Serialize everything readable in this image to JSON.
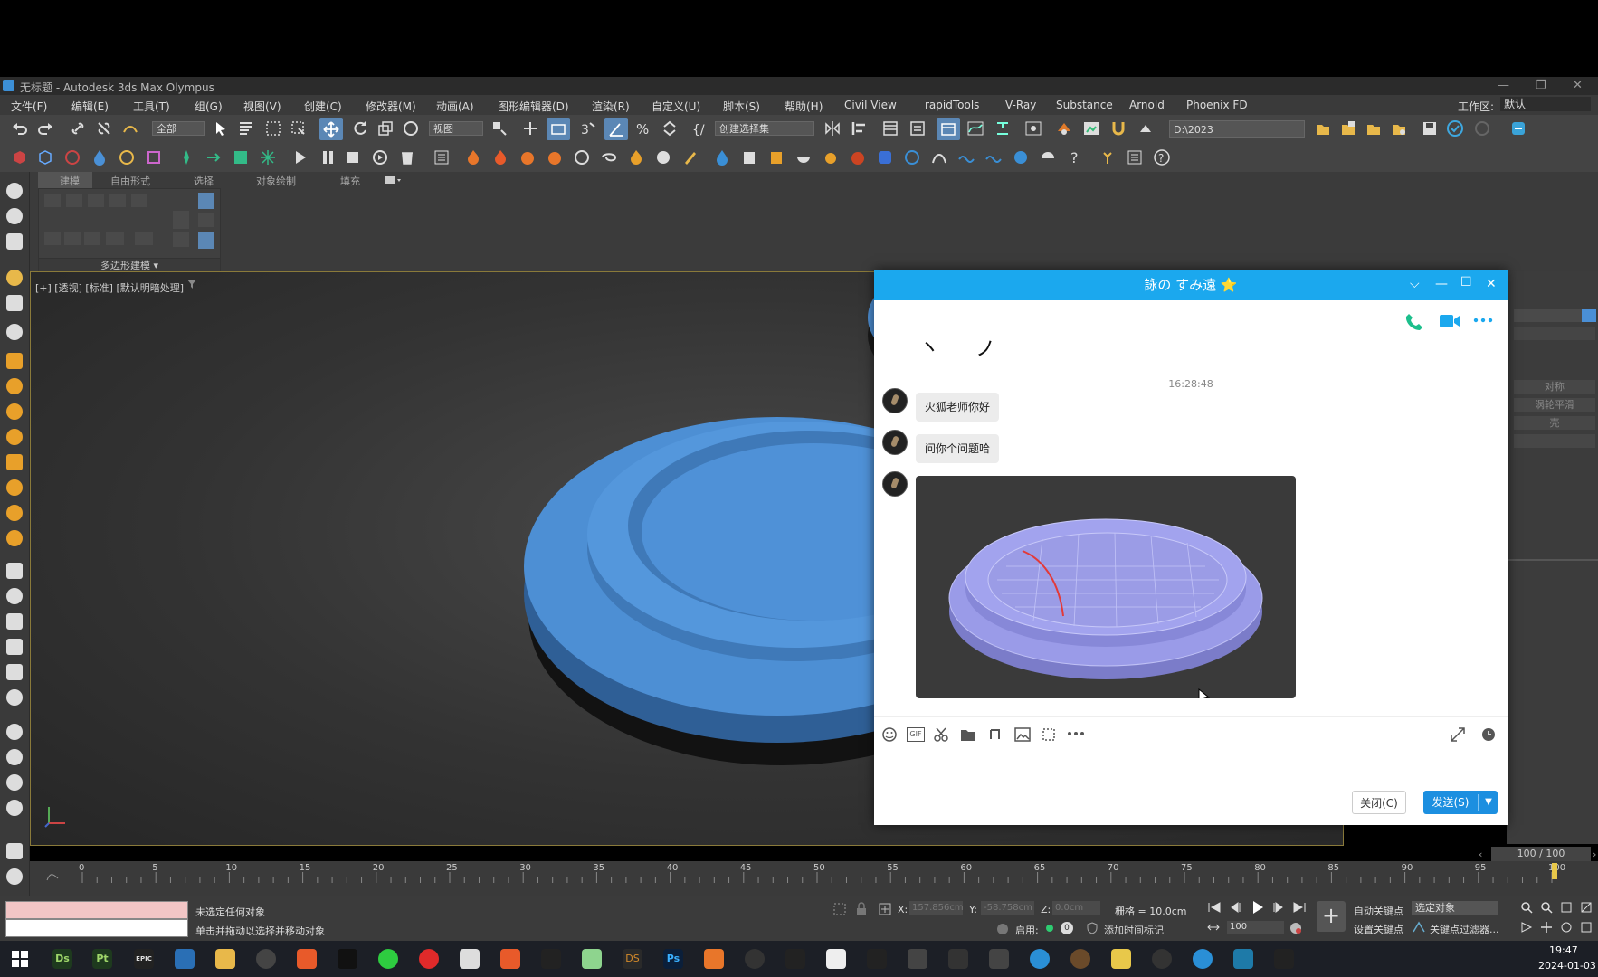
{
  "window": {
    "title": "无标题 - Autodesk 3ds Max Olympus",
    "controls": [
      "—",
      "❐",
      "✕"
    ]
  },
  "menu": {
    "items": [
      "文件(F)",
      "编辑(E)",
      "工具(T)",
      "组(G)",
      "视图(V)",
      "创建(C)",
      "修改器(M)",
      "动画(A)",
      "图形编辑器(D)",
      "渲染(R)",
      "自定义(U)",
      "脚本(S)",
      "帮助(H)",
      "Civil View",
      "rapidTools",
      "V-Ray",
      "Substance",
      "Arnold",
      "Phoenix FD"
    ],
    "workspace_label": "工作区:",
    "workspace_value": "默认"
  },
  "toolbar": {
    "selection_filter": "全部",
    "ref_coord": "视图",
    "named_selection": "创建选择集",
    "project_path": "D:\\2023"
  },
  "ribbon": {
    "tabs": [
      "建模",
      "自由形式",
      "选择",
      "对象绘制",
      "填充"
    ],
    "panel_label": "多边形建模"
  },
  "viewport": {
    "label": "[+] [透视] [标准] [默认明暗处理]",
    "model_color": "#4d8fd4"
  },
  "right_panel": {
    "items": [
      "对称",
      "涡轮平滑",
      "壳"
    ]
  },
  "timeline": {
    "frame_display": "100 / 100",
    "ticks": [
      "0",
      "5",
      "10",
      "15",
      "20",
      "25",
      "30",
      "35",
      "40",
      "45",
      "50",
      "55",
      "60",
      "65",
      "70",
      "75",
      "80",
      "85",
      "90",
      "95",
      "100"
    ]
  },
  "status": {
    "line1": "未选定任何对象",
    "line2": "单击并拖动以选择并移动对象",
    "x_label": "X:",
    "x_value": "157.856cm",
    "y_label": "Y:",
    "y_value": "-58.758cm",
    "z_label": "Z:",
    "z_value": "0.0cm",
    "grid": "栅格 = 10.0cm",
    "enable": "启用:",
    "add_time_tag": "添加时间标记",
    "auto_key": "自动关键点",
    "set_key": "设置关键点",
    "selected_objects": "选定对象",
    "key_filters": "关键点过滤器...",
    "frame_field": "100"
  },
  "chat": {
    "title": "詠の すみ遠 ⭐",
    "header_marks": [
      "ヽ",
      "ノ"
    ],
    "timestamp": "16:28:48",
    "messages": [
      "火狐老师你好",
      "问你个问题哈"
    ],
    "close_button": "关闭(C)",
    "send_button": "发送(S)",
    "gif_label": "GIF"
  },
  "taskbar": {
    "time": "19:47",
    "date": "2024-01-03",
    "apps": [
      "Ds",
      "Pt",
      "EPIC",
      "DS",
      "Ps"
    ]
  },
  "colors": {
    "chat_header": "#1ba8ee",
    "send_button": "#1c8fe0",
    "model_blue": "#4d8fd4",
    "thumb_mesh": "#9a9be8"
  }
}
